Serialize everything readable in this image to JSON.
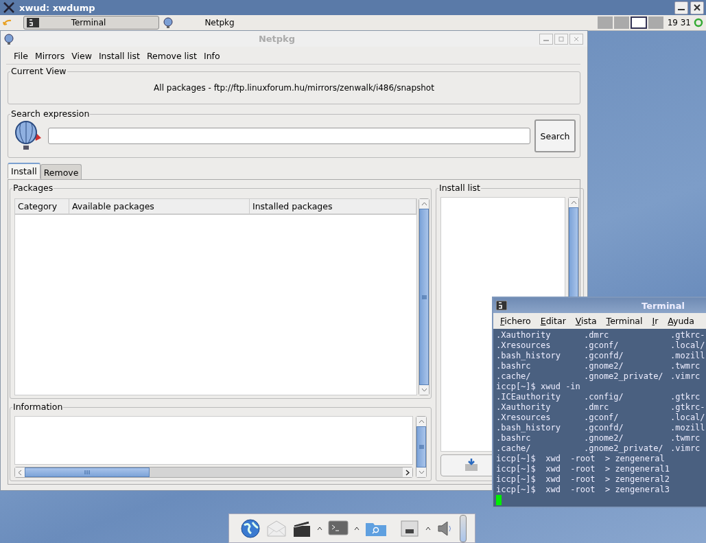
{
  "top_bar": {
    "title": "xwud: xwdump"
  },
  "taskbar": {
    "tasks": [
      {
        "label": "Terminal",
        "selected": true
      },
      {
        "label": "Netpkg",
        "selected": false
      }
    ],
    "workspaces": [
      {
        "selected": false
      },
      {
        "selected": false
      },
      {
        "selected": true
      },
      {
        "selected": false
      }
    ],
    "clock": "19 31"
  },
  "netpkg": {
    "title": "Netpkg",
    "menu": [
      "File",
      "Mirrors",
      "View",
      "Install list",
      "Remove list",
      "Info"
    ],
    "current_view": {
      "label": "Current View",
      "text": "All packages - ftp://ftp.linuxforum.hu/mirrors/zenwalk/i486/snapshot"
    },
    "search": {
      "label": "Search expression",
      "button": "Search"
    },
    "tabs": [
      {
        "label": "Install",
        "selected": true
      },
      {
        "label": "Remove",
        "selected": false
      }
    ],
    "packages": {
      "label": "Packages",
      "columns": [
        "Category",
        "Available packages",
        "Installed packages"
      ]
    },
    "install_list": {
      "label": "Install list"
    },
    "information": {
      "label": "Information"
    }
  },
  "terminal": {
    "title": "Terminal",
    "menu": [
      "Fichero",
      "Editar",
      "Vista",
      "Terminal",
      "Ir",
      "Ayuda"
    ],
    "lines": [
      {
        "kind": "listing",
        "cells": [
          ".Xauthority",
          ".dmrc",
          ".gtkrc-"
        ]
      },
      {
        "kind": "listing",
        "cells": [
          ".Xresources",
          ".gconf/",
          ".local/"
        ]
      },
      {
        "kind": "listing",
        "cells": [
          ".bash_history",
          ".gconfd/",
          ".mozill"
        ]
      },
      {
        "kind": "listing",
        "cells": [
          ".bashrc",
          ".gnome2/",
          ".twmrc"
        ]
      },
      {
        "kind": "listing",
        "cells": [
          ".cache/",
          ".gnome2_private/",
          ".vimrc"
        ]
      },
      {
        "kind": "command",
        "text": "iccp[~]$ xwud -in"
      },
      {
        "kind": "listing",
        "cells": [
          ".ICEauthority",
          ".config/",
          ".gtkrc"
        ]
      },
      {
        "kind": "listing",
        "cells": [
          ".Xauthority",
          ".dmrc",
          ".gtkrc-"
        ]
      },
      {
        "kind": "listing",
        "cells": [
          ".Xresources",
          ".gconf/",
          ".local/"
        ]
      },
      {
        "kind": "listing",
        "cells": [
          ".bash_history",
          ".gconfd/",
          ".mozill"
        ]
      },
      {
        "kind": "listing",
        "cells": [
          ".bashrc",
          ".gnome2/",
          ".twmrc"
        ]
      },
      {
        "kind": "listing",
        "cells": [
          ".cache/",
          ".gnome2_private/",
          ".vimrc"
        ]
      },
      {
        "kind": "command",
        "text": "iccp[~]$  xwd  -root  > zengeneral"
      },
      {
        "kind": "command",
        "text": "iccp[~]$  xwd  -root  > zengeneral1"
      },
      {
        "kind": "command",
        "text": "iccp[~]$  xwd  -root  > zengeneral2"
      },
      {
        "kind": "command",
        "text": "iccp[~]$  xwd  -root  > zengeneral3"
      }
    ]
  }
}
